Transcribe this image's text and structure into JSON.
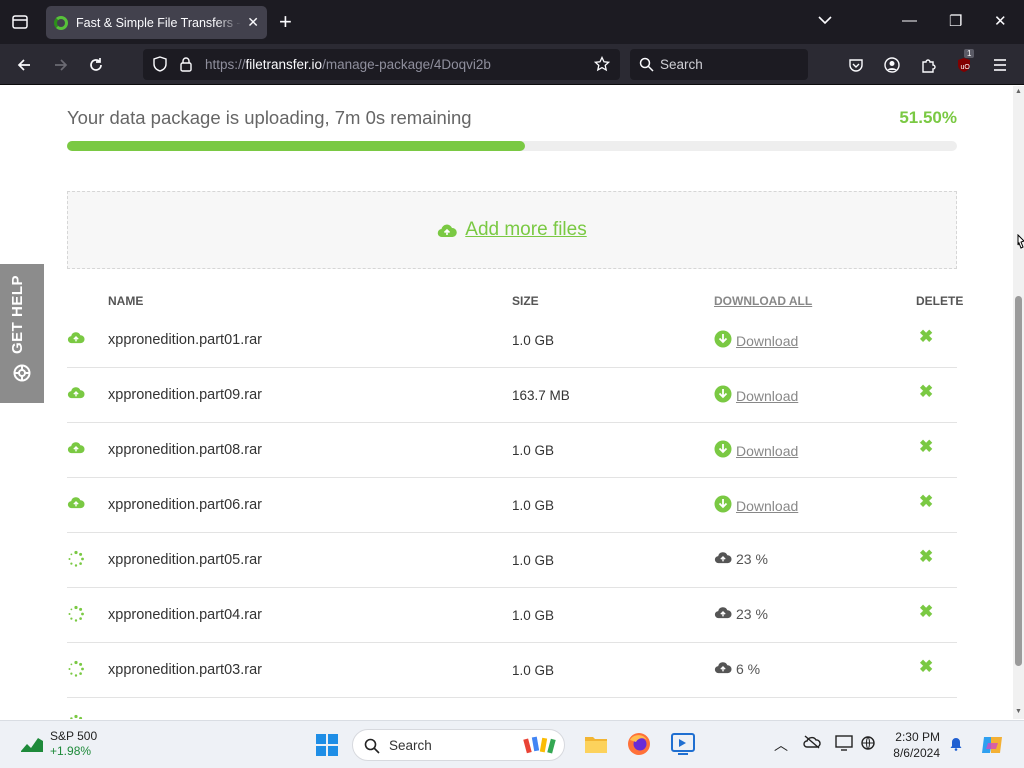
{
  "browser": {
    "tab_title": "Fast & Simple File Transfers - FileTransfer.io",
    "url_prefix": "https://",
    "url_host": "filetransfer.io",
    "url_path": "/manage-package/4Doqvi2b",
    "search_placeholder": "Search",
    "extension_badge": "1"
  },
  "upload": {
    "status": "Your data package is uploading, 7m 0s remaining",
    "percent_label": "51.50%",
    "progress": 0.515,
    "add_files_label": "Add more files"
  },
  "table": {
    "headers": {
      "name": "NAME",
      "size": "SIZE",
      "download_all": "DOWNLOAD ALL",
      "delete": "DELETE"
    },
    "rows": [
      {
        "name": "xppronedition.part01.rar",
        "size": "1.0 GB",
        "state": "done",
        "action": "Download"
      },
      {
        "name": "xppronedition.part09.rar",
        "size": "163.7 MB",
        "state": "done",
        "action": "Download"
      },
      {
        "name": "xppronedition.part08.rar",
        "size": "1.0 GB",
        "state": "done",
        "action": "Download"
      },
      {
        "name": "xppronedition.part06.rar",
        "size": "1.0 GB",
        "state": "done",
        "action": "Download"
      },
      {
        "name": "xppronedition.part05.rar",
        "size": "1.0 GB",
        "state": "uploading",
        "action": "23 %"
      },
      {
        "name": "xppronedition.part04.rar",
        "size": "1.0 GB",
        "state": "uploading",
        "action": "23 %"
      },
      {
        "name": "xppronedition.part03.rar",
        "size": "1.0 GB",
        "state": "uploading",
        "action": "6 %"
      }
    ]
  },
  "gethelp_label": "GET HELP",
  "taskbar": {
    "stock_name": "S&P 500",
    "stock_change": "+1.98%",
    "search_label": "Search",
    "time": "2:30 PM",
    "date": "8/6/2024"
  },
  "colors": {
    "accent": "#7ac943",
    "chrome_dark": "#1c1b22"
  }
}
